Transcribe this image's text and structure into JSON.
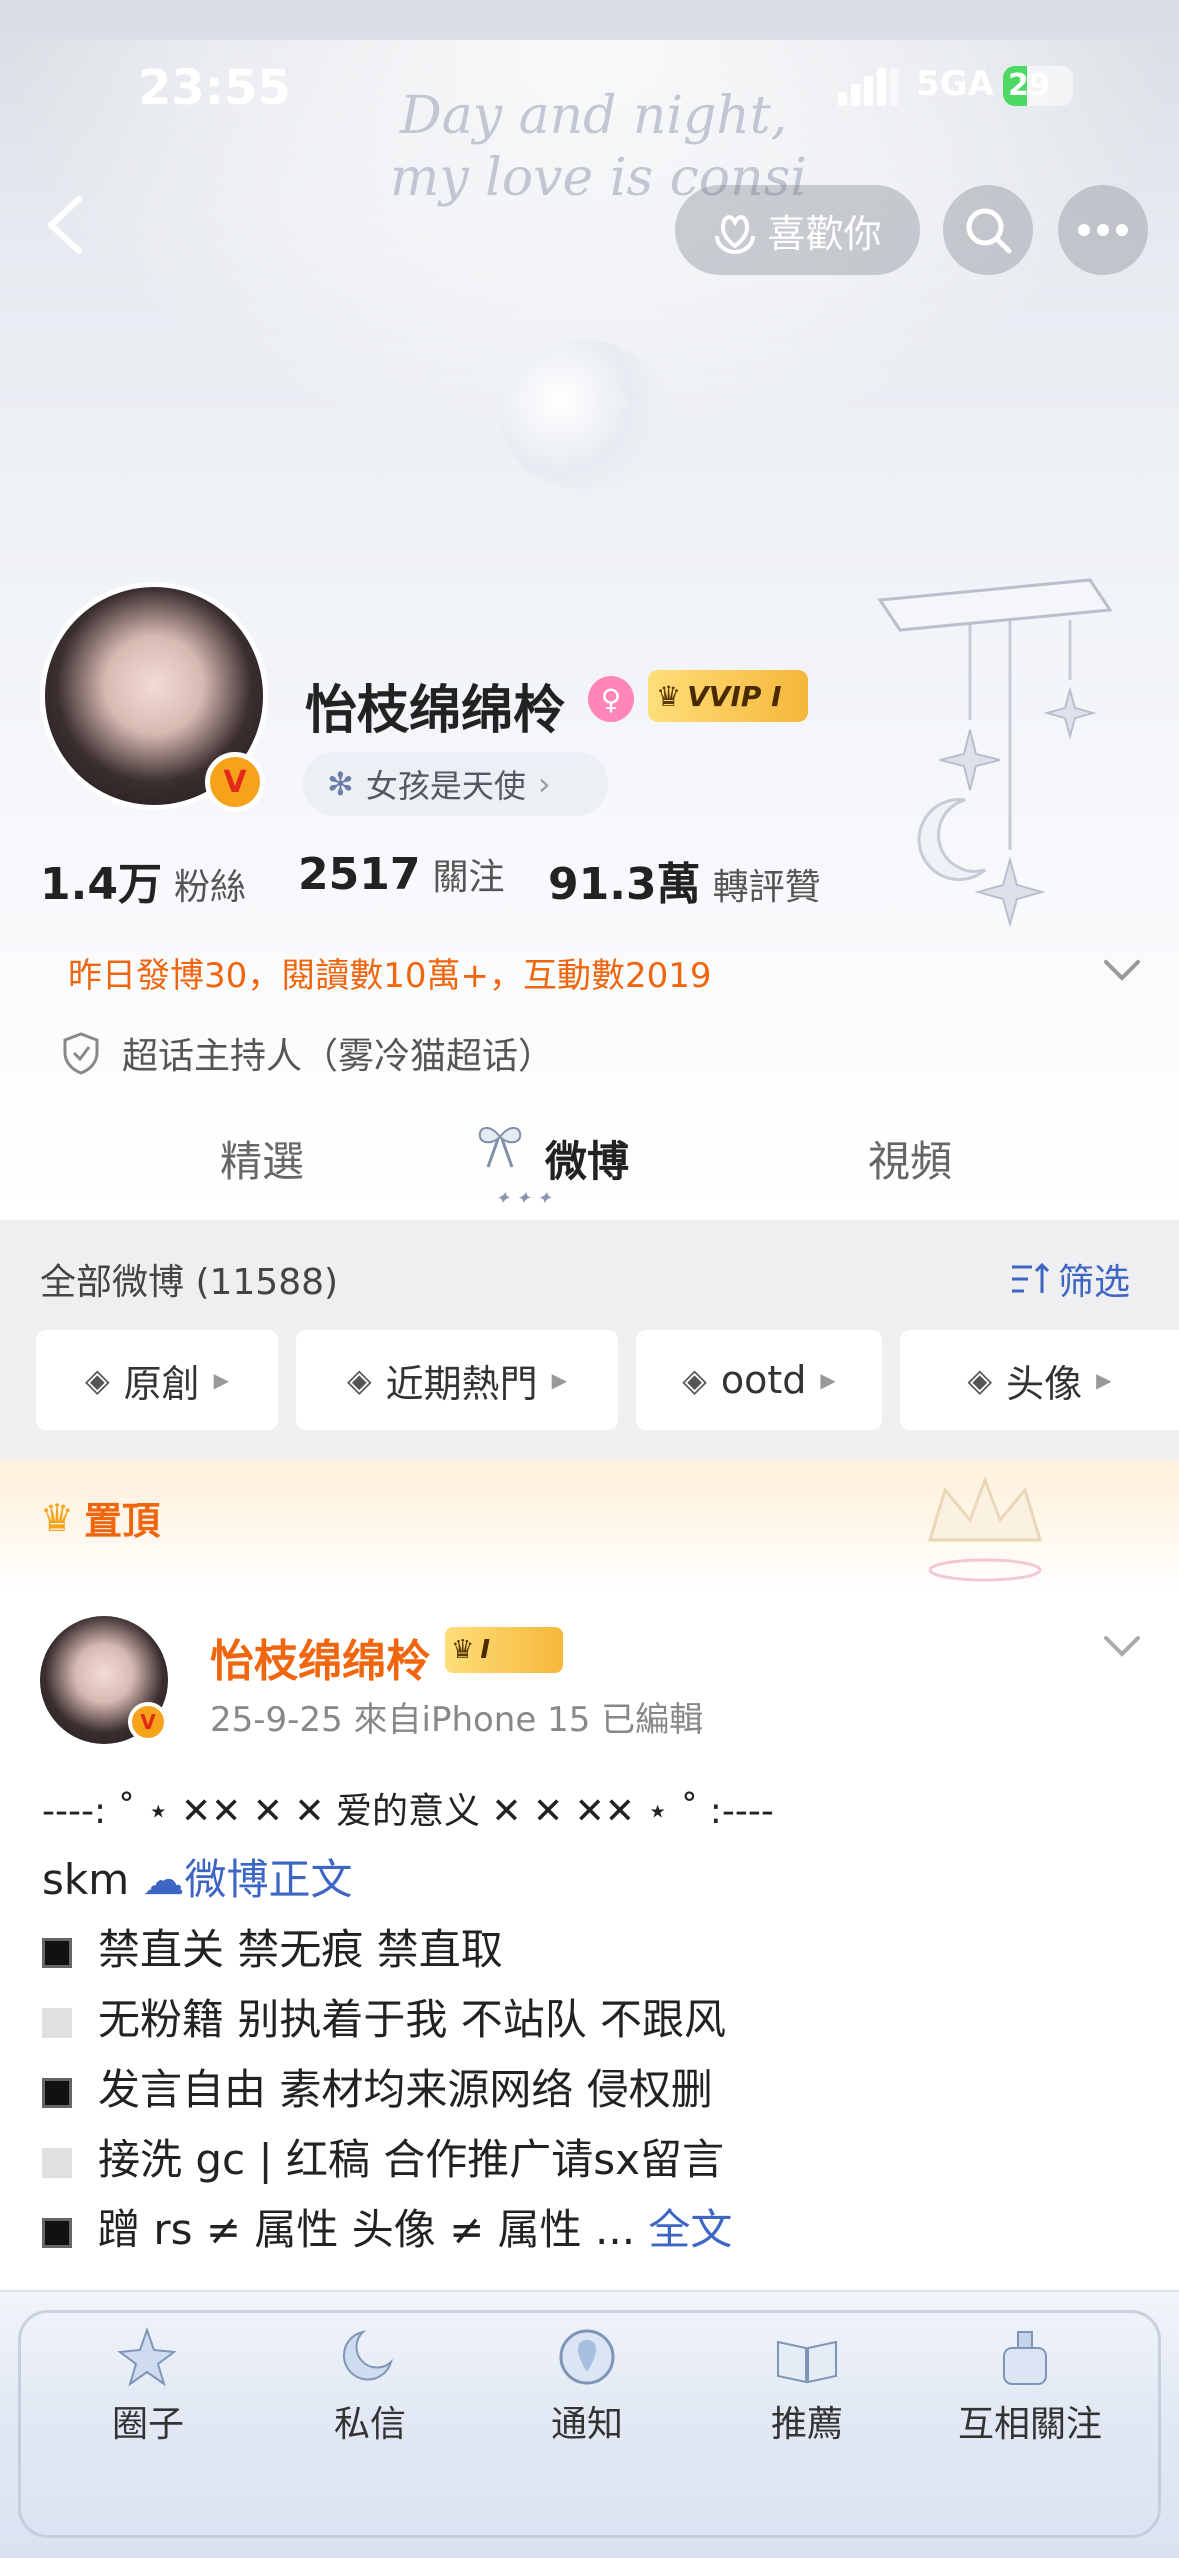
{
  "status_bar": {
    "time": "23:55",
    "network": "5GA",
    "battery": "29"
  },
  "background_text": {
    "script_line1": "Day and night,",
    "script_line2": "my love is consi"
  },
  "nav": {
    "like_label": "喜歡你"
  },
  "profile": {
    "username": "怡枝绵绵柃",
    "vip_label": "VVIP I",
    "bio_tag": "女孩是天使",
    "stats": [
      {
        "value": "1.4万",
        "label": "粉絲"
      },
      {
        "value": "2517",
        "label": "關注"
      },
      {
        "value": "91.3萬",
        "label": "轉評贊"
      }
    ],
    "yesterday_stats": "昨日發博30，閱讀數10萬+，互動數2019",
    "host_text": "超话主持人（雾冷猫超话）"
  },
  "tabs": [
    {
      "label": "精選"
    },
    {
      "label": "微博"
    },
    {
      "label": "視頻"
    }
  ],
  "filter": {
    "all_weibo": "全部微博 (11588)",
    "filter_label": "筛选",
    "chips": [
      "原創",
      "近期熱門",
      "ootd",
      "头像"
    ]
  },
  "pinned_label": "置頂",
  "post": {
    "username": "怡枝绵绵柃",
    "vip_label": "I",
    "meta": "25-9-25  來自iPhone 15  已編輯",
    "line1": "----: ˚ ⋆ ✕✕ ✕ ✕ 爱的意义 ✕ ✕ ✕✕ ⋆ ˚ :----",
    "line2_prefix": "skm ",
    "line2_link": "微博正文",
    "lines": [
      "禁直关  禁无痕  禁直取",
      "无粉籍 别执着于我 不站队 不跟风",
      "发言自由 素材均来源网络 侵权删",
      "接洗 gc | 红稿  合作推广请sx留言",
      "蹭 rs ≠ 属性 头像 ≠ 属性 ... "
    ],
    "full_text_link": "全文"
  },
  "bottom_nav": [
    "圈子",
    "私信",
    "通知",
    "推薦",
    "互相關注"
  ]
}
